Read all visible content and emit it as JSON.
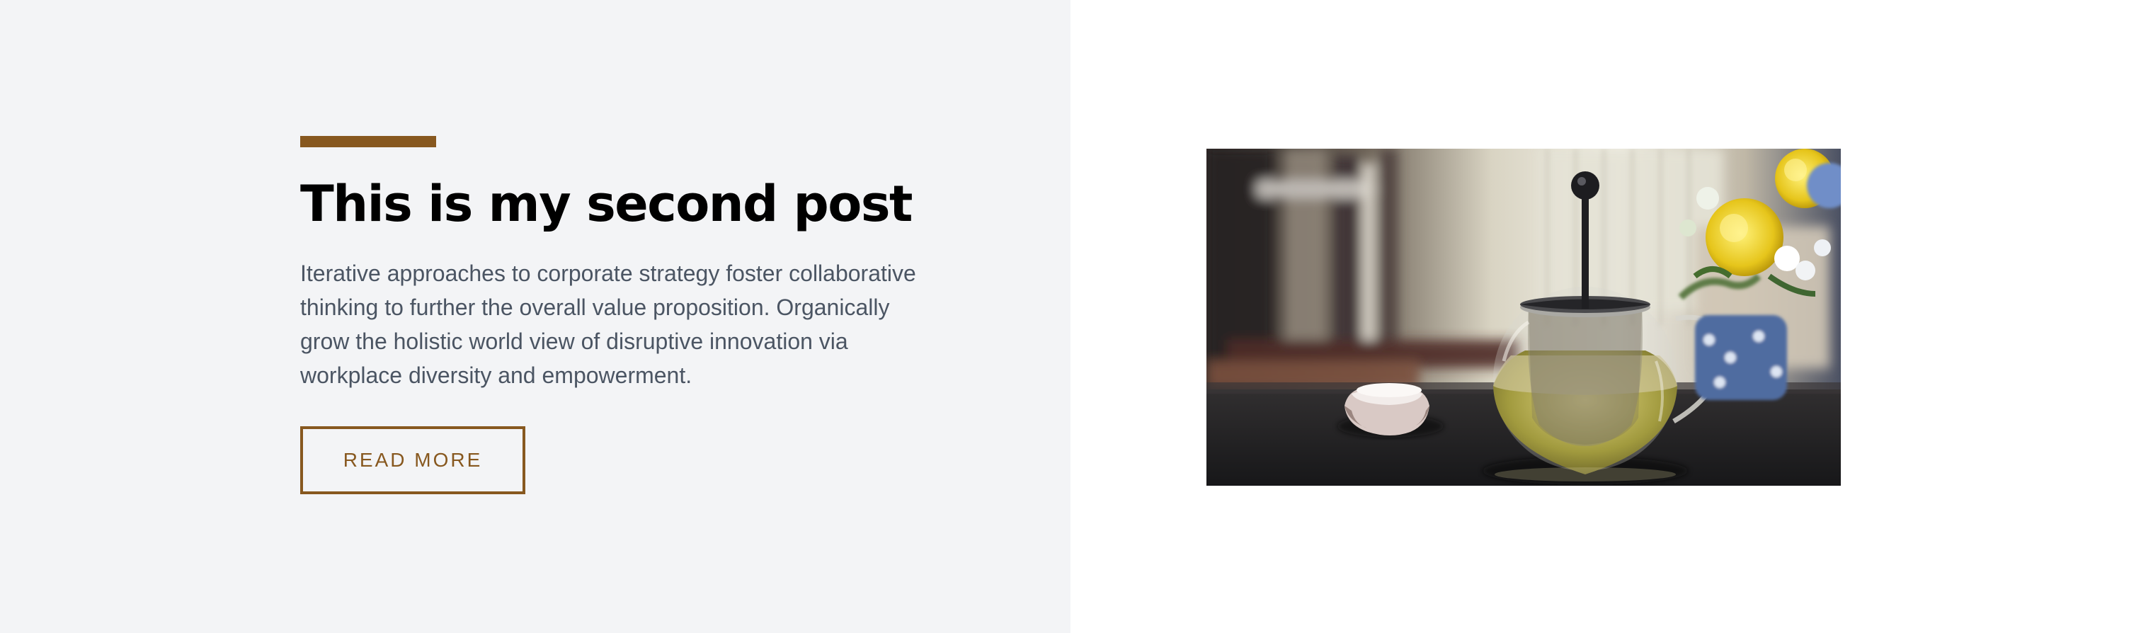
{
  "post": {
    "title": "This is my second post",
    "excerpt": "Iterative approaches to corporate strategy foster collaborative thinking to further the overall value proposition. Organically grow the holistic world view of disruptive innovation via workplace diversity and empowerment.",
    "button_label": "READ MORE"
  },
  "colors": {
    "accent": "#87581f",
    "left_background": "#f3f4f6",
    "title": "#000000",
    "body_text": "#4b5563"
  },
  "image": {
    "subject": "glass teapot with tea, small cup and yellow flowers"
  }
}
